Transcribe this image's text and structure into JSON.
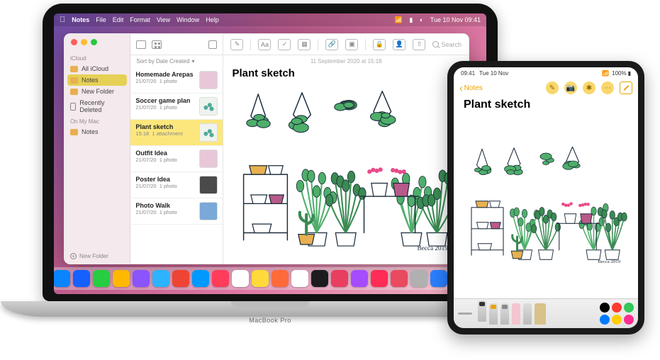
{
  "mac": {
    "menubar": {
      "app": "Notes",
      "items": [
        "File",
        "Edit",
        "Format",
        "View",
        "Window",
        "Help"
      ],
      "clock": "Tue 10 Nov  09:41"
    },
    "label": "MacBook Pro"
  },
  "sidebar": {
    "section1": "iCloud",
    "items1": [
      {
        "label": "All iCloud"
      },
      {
        "label": "Notes",
        "selected": true
      },
      {
        "label": "New Folder"
      },
      {
        "label": "Recently Deleted"
      }
    ],
    "section2": "On My Mac",
    "items2": [
      {
        "label": "Notes"
      }
    ],
    "newFolder": "New Folder"
  },
  "list": {
    "sort": "Sort by Date Created",
    "items": [
      {
        "title": "Homemade Arepas",
        "date": "21/07/20",
        "meta": "1 photo",
        "thumb": "pink"
      },
      {
        "title": "Soccer game plan",
        "date": "21/07/20",
        "meta": "1 photo",
        "thumb": "plant"
      },
      {
        "title": "Plant sketch",
        "date": "15:18",
        "meta": "1 attachment",
        "thumb": "plant",
        "selected": true
      },
      {
        "title": "Outfit Idea",
        "date": "21/07/20",
        "meta": "1 photo",
        "thumb": "pink"
      },
      {
        "title": "Poster Idea",
        "date": "21/07/20",
        "meta": "1 photo",
        "thumb": "dark"
      },
      {
        "title": "Photo Walk",
        "date": "21/07/20",
        "meta": "1 photo",
        "thumb": "blue"
      }
    ]
  },
  "editor": {
    "date": "11 September 2020 at 15:18",
    "title": "Plant sketch",
    "searchPlaceholder": "Search",
    "signature": "Becca 2019"
  },
  "dock": {
    "apps": [
      "#0a84ff",
      "#1560ff",
      "#27cd41",
      "#ffb800",
      "#8a54ff",
      "#2db3ff",
      "#ee4433",
      "#0099ff",
      "#ff3c5a",
      "#ffffff",
      "#ffda3a",
      "#ff6a3a",
      "#ffffff",
      "#1c1c1e",
      "#e83e60",
      "#a54cff",
      "#ff2d55",
      "#e84a5f",
      "#b0b0b0",
      "#2a7fff",
      "#2a2a2a",
      "#0a84ff"
    ]
  },
  "ipad": {
    "status": {
      "time": "09:41",
      "date": "Tue 10 Nov",
      "battery": "100%"
    },
    "back": "Notes",
    "title": "Plant sketch",
    "palette": {
      "colors": [
        "#000000",
        "#ff3b30",
        "#34c759",
        "#007aff",
        "#ffcc00",
        "#ff2d92"
      ]
    }
  }
}
